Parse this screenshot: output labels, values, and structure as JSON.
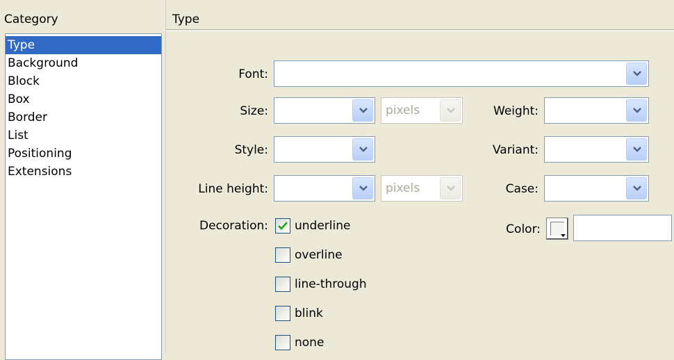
{
  "category_header": "Category",
  "panel_title": "Type",
  "categories": [
    "Type",
    "Background",
    "Block",
    "Box",
    "Border",
    "List",
    "Positioning",
    "Extensions"
  ],
  "selected_category": "Type",
  "fields": {
    "font": {
      "label": "Font:",
      "value": ""
    },
    "size": {
      "label": "Size:",
      "value": "",
      "unit": "pixels"
    },
    "weight": {
      "label": "Weight:",
      "value": ""
    },
    "style": {
      "label": "Style:",
      "value": ""
    },
    "variant": {
      "label": "Variant:",
      "value": ""
    },
    "line_height": {
      "label": "Line height:",
      "value": "",
      "unit": "pixels"
    },
    "case": {
      "label": "Case:",
      "value": ""
    },
    "color": {
      "label": "Color:",
      "value": ""
    }
  },
  "decoration": {
    "label": "Decoration:",
    "options": [
      {
        "label": "underline",
        "checked": true
      },
      {
        "label": "overline",
        "checked": false
      },
      {
        "label": "line-through",
        "checked": false
      },
      {
        "label": "blink",
        "checked": false
      },
      {
        "label": "none",
        "checked": false
      }
    ]
  },
  "colors": {
    "selection": "#316ac5",
    "dialog_background": "#ece9d8",
    "field_border": "#7f9db9",
    "check_mark": "#21a121"
  }
}
